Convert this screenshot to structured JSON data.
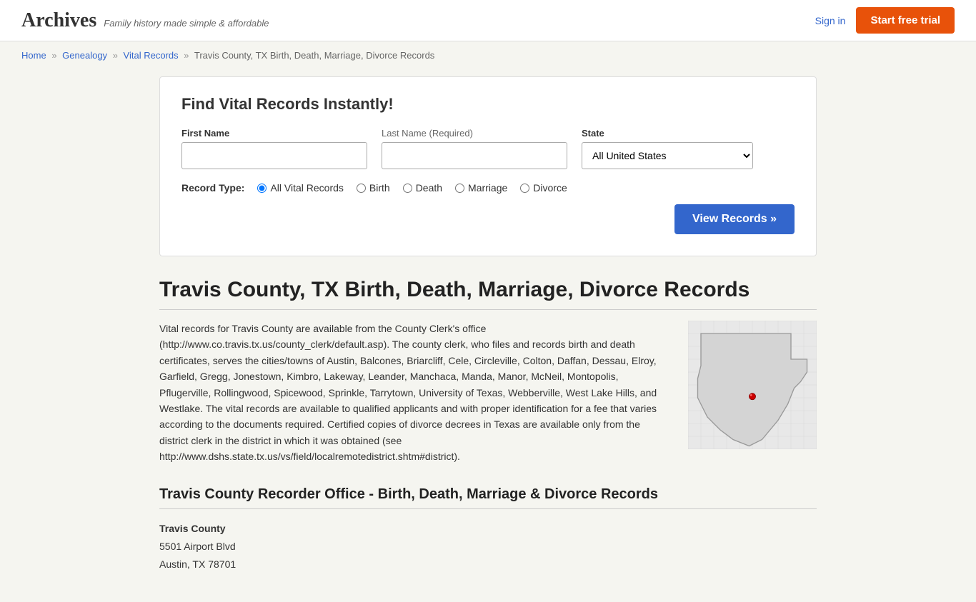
{
  "header": {
    "logo": "Archives",
    "tagline": "Family history made simple & affordable",
    "sign_in": "Sign in",
    "start_trial": "Start free trial"
  },
  "breadcrumb": {
    "home": "Home",
    "genealogy": "Genealogy",
    "vital_records": "Vital Records",
    "current": "Travis County, TX Birth, Death, Marriage, Divorce Records"
  },
  "search": {
    "title": "Find Vital Records Instantly!",
    "first_name_label": "First Name",
    "last_name_label": "Last Name",
    "last_name_required": "(Required)",
    "state_label": "State",
    "state_default": "All United States",
    "record_type_label": "Record Type:",
    "record_types": [
      {
        "id": "all",
        "label": "All Vital Records",
        "checked": true
      },
      {
        "id": "birth",
        "label": "Birth",
        "checked": false
      },
      {
        "id": "death",
        "label": "Death",
        "checked": false
      },
      {
        "id": "marriage",
        "label": "Marriage",
        "checked": false
      },
      {
        "id": "divorce",
        "label": "Divorce",
        "checked": false
      }
    ],
    "view_records_button": "View Records »"
  },
  "page": {
    "title": "Travis County, TX Birth, Death, Marriage, Divorce Records",
    "body_text": "Vital records for Travis County are available from the County Clerk's office (http://www.co.travis.tx.us/county_clerk/default.asp). The county clerk, who files and records birth and death certificates, serves the cities/towns of Austin, Balcones, Briarcliff, Cele, Circleville, Colton, Daffan, Dessau, Elroy, Garfield, Gregg, Jonestown, Kimbro, Lakeway, Leander, Manchaca, Manda, Manor, McNeil, Montopolis, Pflugerville, Rollingwood, Spicewood, Sprinkle, Tarrytown, University of Texas, Webberville, West Lake Hills, and Westlake. The vital records are available to qualified applicants and with proper identification for a fee that varies according to the documents required. Certified copies of divorce decrees in Texas are available only from the district clerk in the district in which it was obtained (see http://www.dshs.state.tx.us/vs/field/localremotedistrict.shtm#district).",
    "recorder_section": "Travis County Recorder Office - Birth, Death, Marriage & Divorce Records",
    "office_name": "Travis County",
    "office_address1": "5501 Airport Blvd",
    "office_address2": "Austin, TX 78701"
  }
}
